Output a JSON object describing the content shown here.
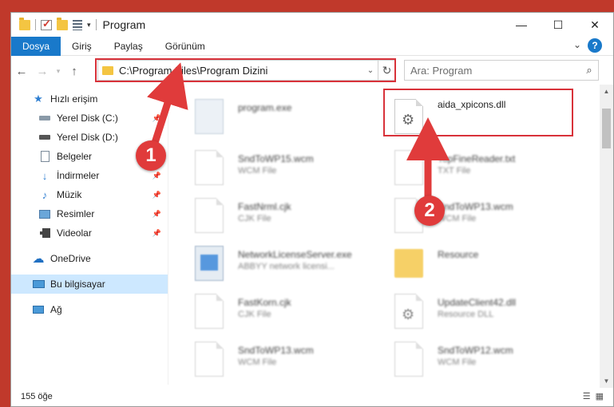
{
  "window": {
    "title": "Program"
  },
  "titlebar": {
    "minimize": "—",
    "maximize": "☐",
    "close": "✕"
  },
  "ribbon": {
    "tabs": [
      {
        "label": "Dosya",
        "active": true
      },
      {
        "label": "Giriş",
        "active": false
      },
      {
        "label": "Paylaş",
        "active": false
      },
      {
        "label": "Görünüm",
        "active": false
      }
    ],
    "help": "?"
  },
  "navigation": {
    "address_path": "C:\\Program Files\\Program Dizini",
    "search_placeholder": "Ara: Program"
  },
  "sidebar": {
    "items": [
      {
        "label": "Hızlı erişim",
        "icon": "star-icon",
        "pinned": false
      },
      {
        "label": "Yerel Disk (C:)",
        "icon": "drive-icon",
        "pinned": true
      },
      {
        "label": "Yerel Disk (D:)",
        "icon": "drive-icon",
        "pinned": true
      },
      {
        "label": "Belgeler",
        "icon": "documents-icon",
        "pinned": true
      },
      {
        "label": "İndirmeler",
        "icon": "download-icon",
        "pinned": true
      },
      {
        "label": "Müzik",
        "icon": "music-icon",
        "pinned": true
      },
      {
        "label": "Resimler",
        "icon": "pictures-icon",
        "pinned": true
      },
      {
        "label": "Videolar",
        "icon": "video-icon",
        "pinned": true
      },
      {
        "label": "OneDrive",
        "icon": "cloud-icon",
        "pinned": false
      },
      {
        "label": "Bu bilgisayar",
        "icon": "computer-icon",
        "pinned": false,
        "selected": true
      },
      {
        "label": "Ağ",
        "icon": "network-icon",
        "pinned": false
      }
    ]
  },
  "files": [
    {
      "name": "program.exe",
      "desc": "",
      "col": 0
    },
    {
      "name": "aida_xpicons.dll",
      "desc": "",
      "col": 1,
      "highlighted": true
    },
    {
      "name": "SndToWP15.wcm",
      "desc": "WCM File",
      "col": 0
    },
    {
      "name": "TopFineReader.txt",
      "desc": "TXT File",
      "col": 1
    },
    {
      "name": "FastNrml.cjk",
      "desc": "CJK File",
      "col": 0
    },
    {
      "name": "SndToWP13.wcm",
      "desc": "WCM File",
      "col": 1
    },
    {
      "name": "NetworkLicenseServer.exe",
      "desc": "ABBYY network licensi...",
      "col": 0
    },
    {
      "name": "Resource",
      "desc": "",
      "col": 1
    },
    {
      "name": "FastKorn.cjk",
      "desc": "CJK File",
      "col": 0
    },
    {
      "name": "UpdateClient42.dll",
      "desc": "Resource DLL",
      "col": 1
    },
    {
      "name": "SndToWP13.wcm",
      "desc": "WCM File",
      "col": 0
    },
    {
      "name": "SndToWP12.wcm",
      "desc": "WCM File",
      "col": 1
    }
  ],
  "status": {
    "item_count": "155 öğe"
  },
  "annotations": {
    "badge1": "1",
    "badge2": "2",
    "color": "#e03b3b"
  }
}
